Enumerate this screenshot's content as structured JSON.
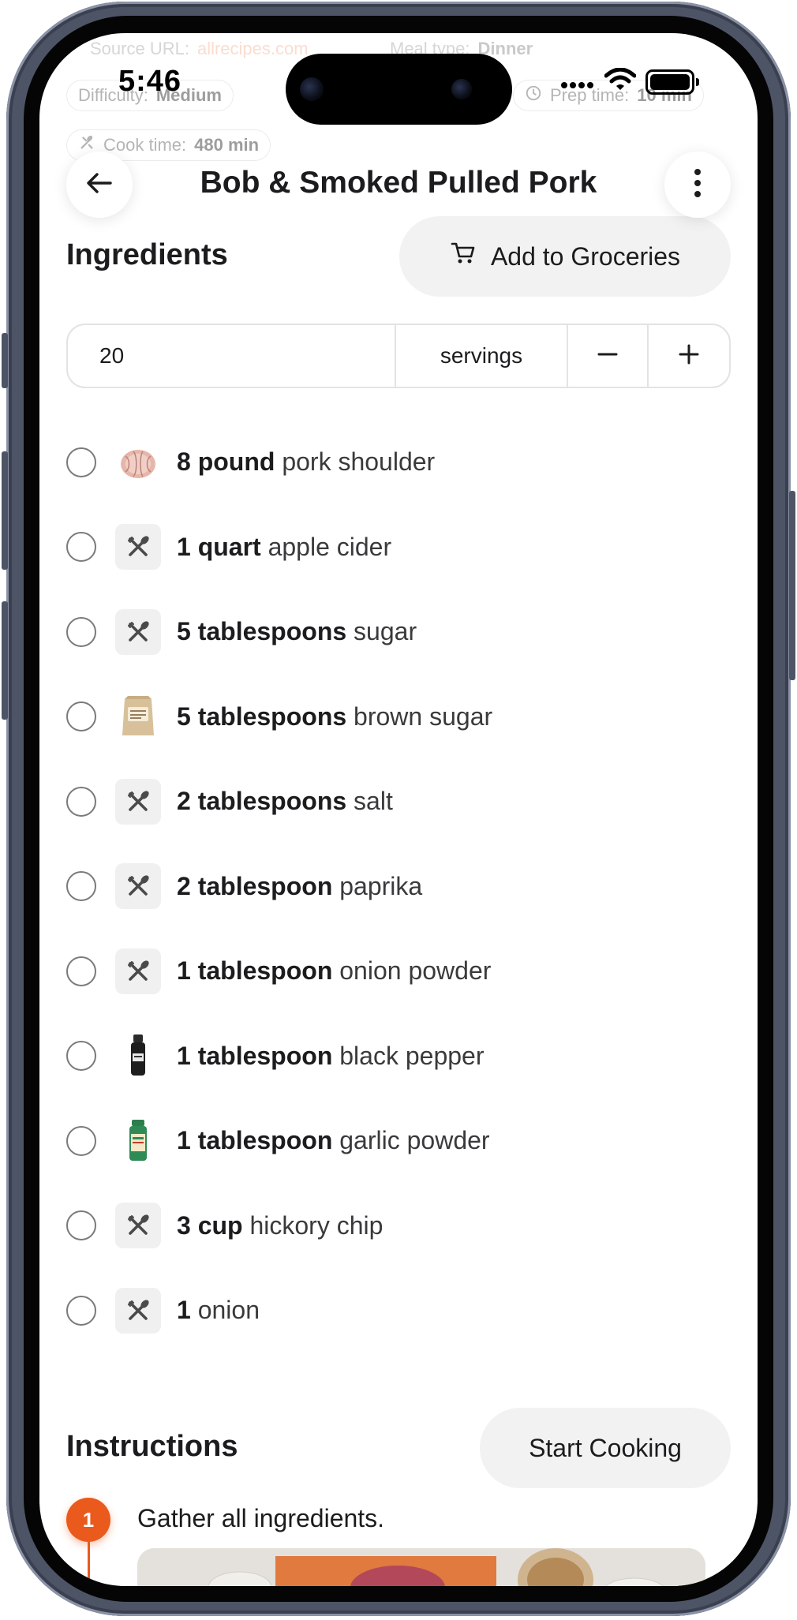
{
  "status_bar": {
    "time": "5:46"
  },
  "meta": {
    "source_label": "Source URL:",
    "source_value": "allrecipes.com",
    "meal_type_label": "Meal type:",
    "meal_type_value": "Dinner",
    "difficulty_label": "Difficulty:",
    "difficulty_value": "Medium",
    "prep_label": "Prep time:",
    "prep_value": "10 min",
    "cook_label": "Cook time:",
    "cook_value": "480 min"
  },
  "header": {
    "title": "Bob & Smoked Pulled Pork"
  },
  "ingredients": {
    "heading": "Ingredients",
    "add_button": "Add to Groceries",
    "servings": {
      "value": "20",
      "unit": "servings",
      "minus": "−",
      "plus": "+"
    },
    "items": [
      {
        "amount": "8 pound",
        "name": "pork shoulder",
        "thumb": "pork"
      },
      {
        "amount": "1 quart",
        "name": "apple cider",
        "thumb": "placeholder"
      },
      {
        "amount": "5 tablespoons",
        "name": "sugar",
        "thumb": "placeholder"
      },
      {
        "amount": "5 tablespoons",
        "name": "brown sugar",
        "thumb": "brown-sugar-bag"
      },
      {
        "amount": "2 tablespoons",
        "name": "salt",
        "thumb": "placeholder"
      },
      {
        "amount": "2 tablespoon",
        "name": "paprika",
        "thumb": "placeholder"
      },
      {
        "amount": "1 tablespoon",
        "name": "onion powder",
        "thumb": "placeholder"
      },
      {
        "amount": "1 tablespoon",
        "name": "black pepper",
        "thumb": "pepper-grinder"
      },
      {
        "amount": "1 tablespoon",
        "name": "garlic powder",
        "thumb": "garlic-jar"
      },
      {
        "amount": "3 cup",
        "name": "hickory chip",
        "thumb": "placeholder"
      },
      {
        "amount": "1",
        "name": "onion",
        "thumb": "placeholder"
      }
    ]
  },
  "instructions": {
    "heading": "Instructions",
    "start_button": "Start Cooking",
    "steps": [
      {
        "number": "1",
        "text": "Gather all ingredients."
      }
    ]
  },
  "colors": {
    "accent": "#ea5a1d",
    "button_bg": "#f2f2f2",
    "placeholder_bg": "#f0f0f0"
  }
}
